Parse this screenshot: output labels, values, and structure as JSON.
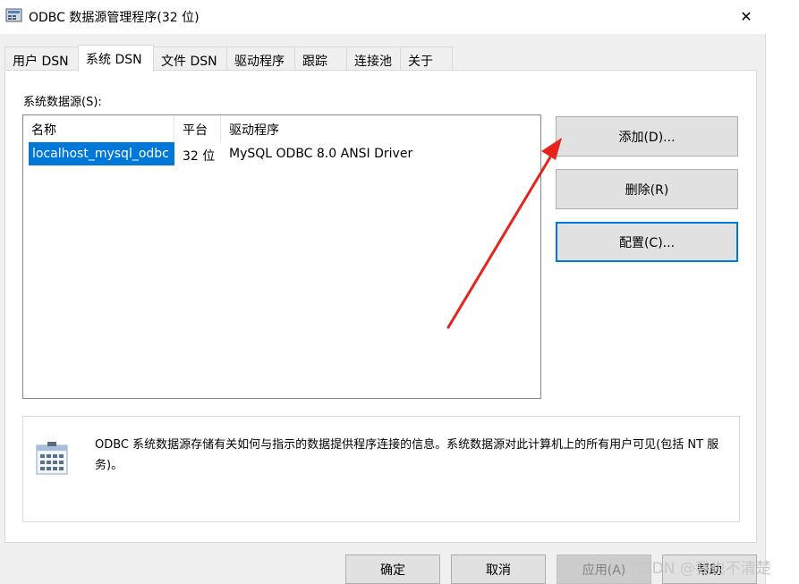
{
  "window": {
    "title": "ODBC 数据源管理程序(32 位)",
    "close_glyph": "✕"
  },
  "tabs": [
    {
      "label": "用户 DSN",
      "active": false
    },
    {
      "label": "系统 DSN",
      "active": true
    },
    {
      "label": "文件 DSN",
      "active": false
    },
    {
      "label": "驱动程序",
      "active": false
    },
    {
      "label": "跟踪",
      "active": false
    },
    {
      "label": "连接池",
      "active": false
    },
    {
      "label": "关于",
      "active": false
    }
  ],
  "system_dsn": {
    "section_label": "系统数据源(S):",
    "columns": [
      "名称",
      "平台",
      "驱动程序"
    ],
    "rows": [
      {
        "name": "localhost_mysql_odbc",
        "platform": "32 位",
        "driver": "MySQL ODBC 8.0 ANSI Driver",
        "selected": true
      }
    ],
    "buttons": {
      "add": "添加(D)...",
      "remove": "删除(R)",
      "configure": "配置(C)..."
    },
    "info_text": "ODBC 系统数据源存储有关如何与指示的数据提供程序连接的信息。系统数据源对此计算机上的所有用户可见(包括 NT 服务)。"
  },
  "footer": {
    "ok": "确定",
    "cancel": "取消",
    "apply": "应用(A)",
    "help": "帮助"
  },
  "watermark": "CSDN @我也不清楚",
  "icons": {
    "app": "odbc-admin-icon",
    "close": "close-icon",
    "info": "data-source-icon"
  },
  "colors": {
    "selection": "#0078d7",
    "annotation_arrow": "#e8221c",
    "window_bg": "#f0f0f0"
  }
}
